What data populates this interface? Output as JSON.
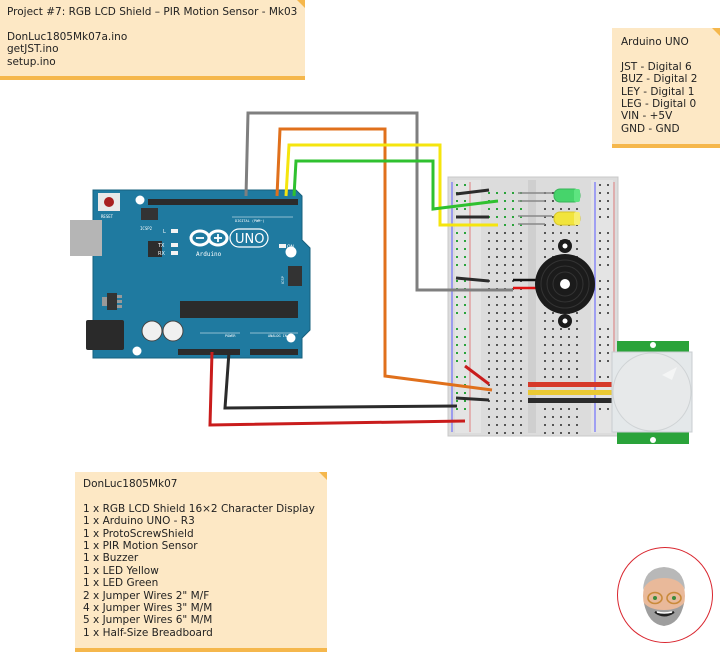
{
  "project_note": {
    "title": "Project #7: RGB LCD Shield – PIR Motion Sensor - Mk03",
    "files": [
      "DonLuc1805Mk07a.ino",
      "getJST.ino",
      "setup.ino"
    ]
  },
  "pins_note": {
    "title": "Arduino UNO",
    "pins": [
      "JST - Digital 6",
      "BUZ - Digital 2",
      "LEY - Digital 1",
      "LEG - Digital 0",
      "VIN - +5V",
      "GND - GND"
    ]
  },
  "parts_note": {
    "title": "DonLuc1805Mk07",
    "parts": [
      "1 x RGB LCD Shield 16×2 Character Display",
      "1 x Arduino UNO - R3",
      "1 x ProtoScrewShield",
      "1 x PIR Motion Sensor",
      "1 x Buzzer",
      "1 x LED Yellow",
      "1 x LED Green",
      "2 x Jumper Wires 2\" M/F",
      "4 x Jumper Wires 3\" M/M",
      "5 x Jumper Wires 6\" M/M",
      "1 x Half-Size Breadboard"
    ]
  },
  "arduino": {
    "reset_label": "RESET",
    "icsp2_label": "ICSP2",
    "icsp_label": "ICSP",
    "logo_text": "UNO",
    "brand": "Arduino",
    "digital_label": "DIGITAL (PWM~)",
    "power_label": "POWER",
    "analog_label": "ANALOG IN",
    "led_l": "L",
    "led_tx": "TX",
    "led_rx": "RX",
    "led_on": "ON",
    "board_color": "#1f7aa0"
  },
  "wire_colors": {
    "gray": "#7f7f7f",
    "orange": "#e0701c",
    "yellow": "#f5e50e",
    "green": "#2fc12f",
    "black": "#2b2b2b",
    "red": "#c91c1c"
  },
  "components": {
    "led_green": "LED Green",
    "led_yellow": "LED Yellow",
    "buzzer": "Buzzer",
    "pir": "PIR Motion Sensor",
    "breadboard": "Half-Size Breadboard"
  }
}
